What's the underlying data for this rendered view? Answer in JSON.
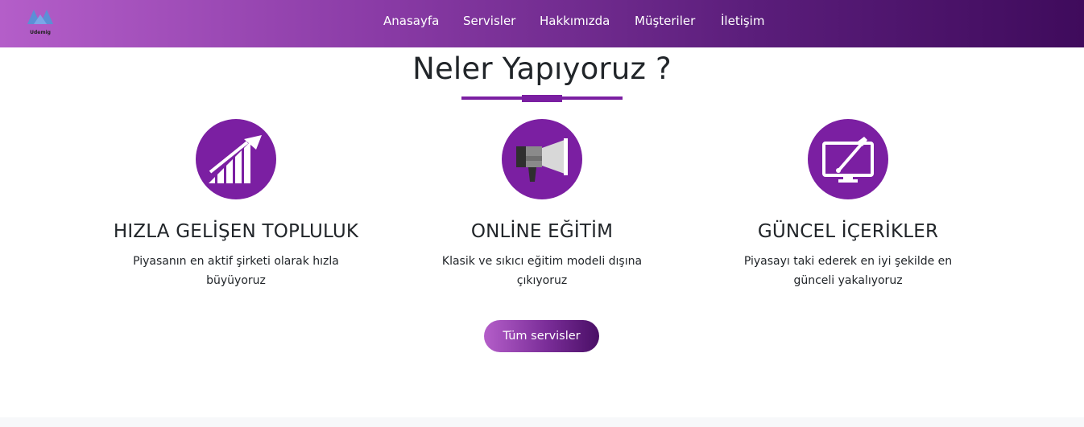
{
  "brand": {
    "name": "Udemig",
    "logo_icon": "twin-peaks-logo-icon"
  },
  "nav": {
    "items": [
      {
        "label": "Anasayfa"
      },
      {
        "label": "Servisler"
      },
      {
        "label": "Hakkımızda"
      },
      {
        "label": "Müşteriler"
      },
      {
        "label": "İletişim"
      }
    ]
  },
  "section": {
    "title": "Neler Yapıyoruz ?"
  },
  "services": [
    {
      "icon": "growth-chart-icon",
      "title": "HIZLA GELİŞEN TOPLULUK",
      "text": "Piyasanın en aktif şirketi olarak hızla büyüyoruz"
    },
    {
      "icon": "megaphone-icon",
      "title": "ONLİNE EĞİTİM",
      "text": "Klasik ve sıkıcı eğitim modeli dışına çıkıyoruz"
    },
    {
      "icon": "monitor-brush-icon",
      "title": "GÜNCEL İÇERİKLER",
      "text": "Piyasayı taki ederek en iyi şekilde en günceli yakalıyoruz"
    }
  ],
  "cta": {
    "label": "Tüm servisler"
  },
  "colors": {
    "accent": "#7b1fa2",
    "gradient_start": "#b45ec9",
    "gradient_end": "#3f0b5c"
  }
}
